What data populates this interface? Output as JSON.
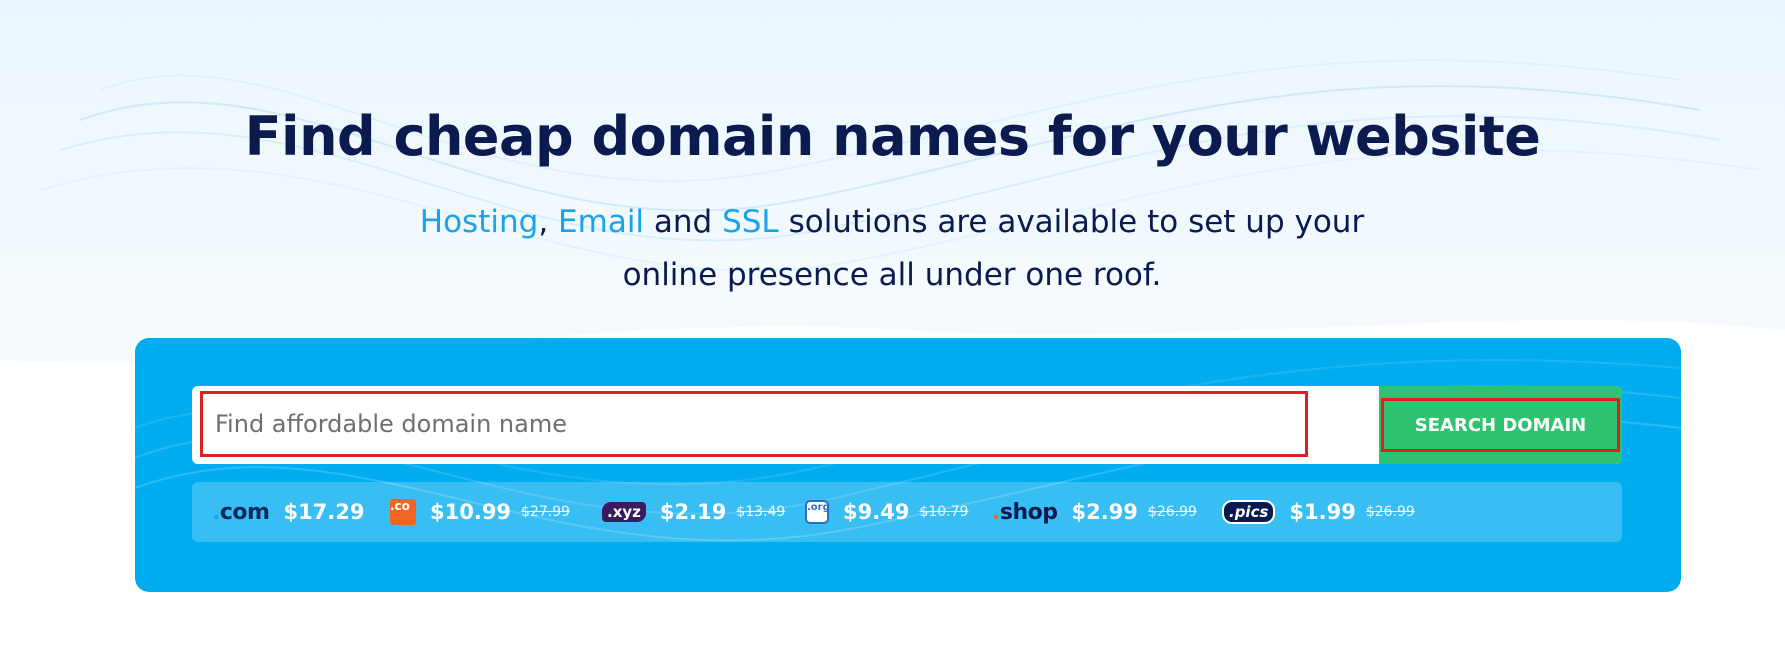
{
  "hero": {
    "title": "Find cheap domain names for your website",
    "subtitle": {
      "link1": "Hosting",
      "sep1": ", ",
      "link2": "Email",
      "sep2": " and ",
      "link3": "SSL",
      "rest1": " solutions are available to set up your",
      "rest2": "online presence all under one roof."
    }
  },
  "search": {
    "placeholder": "Find affordable domain name",
    "value": "",
    "button_label": "SEARCH DOMAIN"
  },
  "tlds": [
    {
      "logo_text": "com",
      "logo_dot": ".",
      "icon": "dot-com-logo",
      "price": "$17.29",
      "old_price": ""
    },
    {
      "logo_text": ".co",
      "icon": "dot-co-logo",
      "price": "$10.99",
      "old_price": "$27.99"
    },
    {
      "logo_text": ".xyz",
      "icon": "dot-xyz-logo",
      "price": "$2.19",
      "old_price": "$13.49"
    },
    {
      "logo_text": ".org",
      "icon": "dot-org-logo",
      "price": "$9.49",
      "old_price": "$10.79"
    },
    {
      "logo_text": "shop",
      "logo_dot": ".",
      "icon": "dot-shop-logo",
      "price": "$2.99",
      "old_price": "$26.99"
    },
    {
      "logo_text": ".pics",
      "icon": "dot-pics-logo",
      "price": "$1.99",
      "old_price": "$26.99"
    }
  ],
  "colors": {
    "title": "#0b1b4f",
    "link": "#1aa3e8",
    "panel": "#00acf0",
    "button": "#2ec371",
    "highlight_border": "#e01f1f"
  }
}
